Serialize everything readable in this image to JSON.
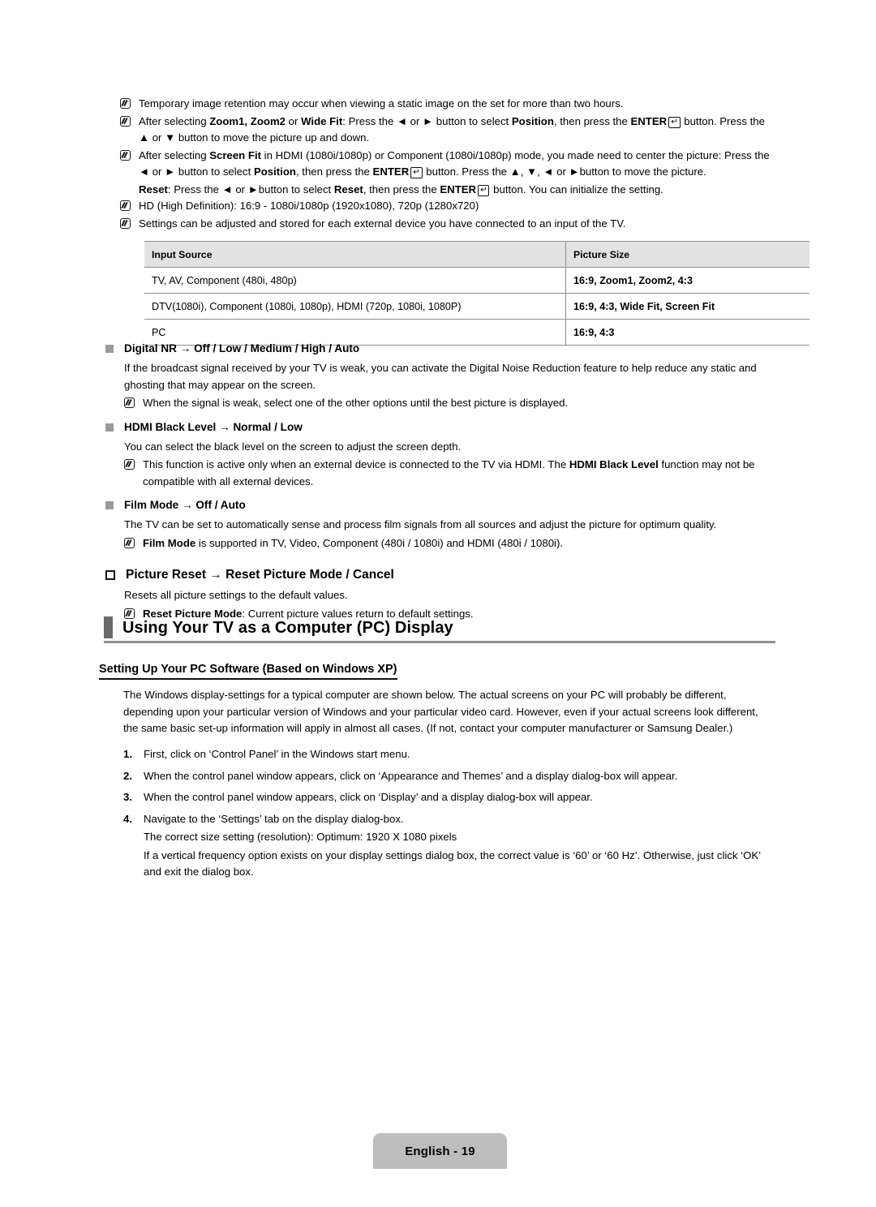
{
  "document": {
    "page_label": "English - 19"
  },
  "top_notes": [
    {
      "id": "note-image-retention",
      "segments": [
        {
          "t": "Temporary image retention may occur when viewing a static image on the set for more than two hours.",
          "b": false
        }
      ]
    },
    {
      "id": "note-zoom-position",
      "segments": [
        {
          "t": "After selecting ",
          "b": false
        },
        {
          "t": "Zoom1, Zoom2",
          "b": true
        },
        {
          "t": " or ",
          "b": false
        },
        {
          "t": "Wide Fit",
          "b": true
        },
        {
          "t": ": Press the ◄ or ► button to select ",
          "b": false
        },
        {
          "t": "Position",
          "b": true
        },
        {
          "t": ", then press the ",
          "b": false
        },
        {
          "t": "ENTER",
          "b": true
        },
        {
          "t": "__ENTERKEY__",
          "b": false
        },
        {
          "t": " button. Press the ▲ or ▼ button to move the picture up and down.",
          "b": false
        }
      ]
    },
    {
      "id": "note-screen-fit",
      "segments": [
        {
          "t": "After selecting ",
          "b": false
        },
        {
          "t": "Screen Fit",
          "b": true
        },
        {
          "t": " in HDMI (1080i/1080p) or Component (1080i/1080p) mode, you made need to center the picture: Press the ◄ or ► button to select ",
          "b": false
        },
        {
          "t": "Position",
          "b": true
        },
        {
          "t": ", then press the ",
          "b": false
        },
        {
          "t": "ENTER",
          "b": true
        },
        {
          "t": "__ENTERKEY__",
          "b": false
        },
        {
          "t": " button. Press the ▲, ▼, ◄ or ►button to move the picture.",
          "b": false
        }
      ],
      "extra_line": [
        {
          "t": "Reset",
          "b": true
        },
        {
          "t": ": Press the ◄ or ►button to select ",
          "b": false
        },
        {
          "t": "Reset",
          "b": true
        },
        {
          "t": ", then press the ",
          "b": false
        },
        {
          "t": "ENTER",
          "b": true
        },
        {
          "t": "__ENTERKEY__",
          "b": false
        },
        {
          "t": " button. You can initialize the setting.",
          "b": false
        }
      ]
    },
    {
      "id": "note-hd-definition",
      "segments": [
        {
          "t": "HD (High Definition): 16:9 - 1080i/1080p (1920x1080), 720p (1280x720)",
          "b": false
        }
      ]
    },
    {
      "id": "note-settings-stored",
      "segments": [
        {
          "t": "Settings can be adjusted and stored for each external device you have connected to an input of the TV.",
          "b": false
        }
      ]
    }
  ],
  "spec_table": {
    "headers": [
      "Input Source",
      "Picture Size"
    ],
    "rows": [
      [
        "TV, AV, Component (480i, 480p)",
        "16:9, Zoom1, Zoom2, 4:3"
      ],
      [
        "DTV(1080i), Component (1080i, 1080p), HDMI (720p, 1080i, 1080P)",
        "16:9, 4:3, Wide Fit, Screen Fit"
      ],
      [
        "PC",
        "16:9, 4:3"
      ]
    ]
  },
  "sections": [
    {
      "id": "digital-nr",
      "marker": "gray-square",
      "title": "Digital NR → Off / Low / Medium / High / Auto",
      "paragraph": "If the broadcast signal received by your TV is weak, you can activate the Digital Noise Reduction feature to help reduce any static and ghosting that may appear on the screen.",
      "notes": [
        [
          {
            "t": "When the signal is weak, select one of the other options until the best picture is displayed.",
            "b": false
          }
        ]
      ]
    },
    {
      "id": "hdmi-black-level",
      "marker": "gray-square",
      "title": "HDMI Black Level → Normal / Low",
      "paragraph": "You can select the black level on the screen to adjust the screen depth.",
      "notes": [
        [
          {
            "t": "This function is active only when an external device is connected to the TV via HDMI. The ",
            "b": false
          },
          {
            "t": "HDMI Black Level",
            "b": true
          },
          {
            "t": " function may not be compatible with all external devices.",
            "b": false
          }
        ]
      ]
    },
    {
      "id": "film-mode",
      "marker": "gray-square",
      "title": "Film Mode → Off / Auto",
      "paragraph": "The TV can be set to automatically sense and process film signals from all sources and adjust the picture for optimum quality.",
      "notes": [
        [
          {
            "t": "Film Mode",
            "b": true
          },
          {
            "t": " is supported in TV, Video, Component (480i / 1080i) and HDMI (480i / 1080i).",
            "b": false
          }
        ]
      ]
    },
    {
      "id": "picture-reset",
      "marker": "hollow-square",
      "title": "Picture Reset → Reset Picture Mode / Cancel",
      "paragraph": "Resets all picture settings to the default values.",
      "notes": [
        [
          {
            "t": "Reset Picture Mode",
            "b": true
          },
          {
            "t": ": Current picture values return to default settings.",
            "b": false
          }
        ]
      ]
    }
  ],
  "pc_display": {
    "heading": "Using Your TV as a Computer (PC) Display",
    "sub_heading": "Setting Up Your PC Software (Based on Windows XP)",
    "intro": "The Windows display-settings for a typical computer are shown below. The actual screens on your PC will probably be different, depending upon your particular version of Windows and your particular video card. However, even if your actual screens look different, the same basic set-up information will apply in almost all cases. (If not, contact your computer manufacturer or Samsung Dealer.)",
    "steps": [
      {
        "num": "1.",
        "text": "First, click on ‘Control Panel’ in the Windows start menu.",
        "sub": []
      },
      {
        "num": "2.",
        "text": "When the control panel window appears, click on ‘Appearance and Themes’ and a display dialog-box will appear.",
        "sub": []
      },
      {
        "num": "3.",
        "text": "When the control panel window appears, click on ‘Display’ and a display dialog-box will appear.",
        "sub": []
      },
      {
        "num": "4.",
        "text": "Navigate to the ‘Settings’ tab on the display dialog-box.",
        "sub": [
          "The correct size setting (resolution): Optimum: 1920 X 1080 pixels",
          "If a vertical frequency option exists on your display settings dialog box, the correct value is ‘60’ or ‘60 Hz’. Otherwise, just click ‘OK’ and exit the dialog box."
        ]
      }
    ]
  },
  "colors": {
    "table_header_bg": "#e2e2e2",
    "rule_gray": "#8f8f8f",
    "heading_bar": "#6b6b6b",
    "footer_badge_bg": "#bdbdbd",
    "bullet_gray": "#9a9a9a"
  }
}
